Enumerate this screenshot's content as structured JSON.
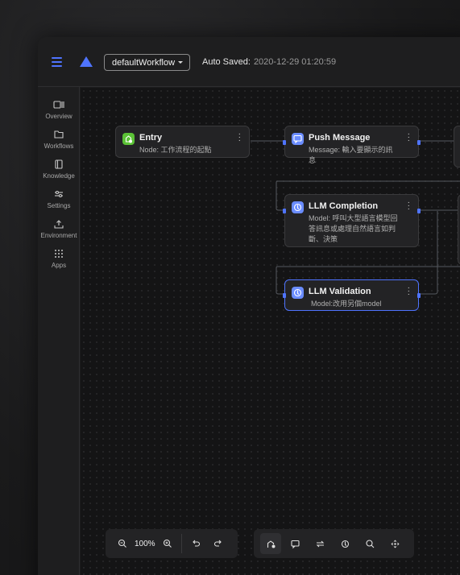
{
  "header": {
    "workflow_name": "defaultWorkflow",
    "autosave_label": "Auto Saved:",
    "autosave_time": "2020-12-29 01:20:59"
  },
  "sidebar": {
    "items": [
      {
        "label": "Overview",
        "icon": "overview-icon"
      },
      {
        "label": "Workflows",
        "icon": "folder-icon"
      },
      {
        "label": "Knowledge",
        "icon": "book-icon"
      },
      {
        "label": "Settings",
        "icon": "sliders-icon"
      },
      {
        "label": "Environment",
        "icon": "upload-icon"
      },
      {
        "label": "Apps",
        "icon": "grid-icon"
      }
    ]
  },
  "nodes": [
    {
      "title": "Entry",
      "desc": "Node: 工作流程的起點",
      "icon": "entry-icon",
      "icon_color": "#5bc236"
    },
    {
      "title": "Push Message",
      "desc": "Message: 輸入要顯示的訊息",
      "icon": "message-icon",
      "icon_color": "#6a8cff"
    },
    {
      "title": "LLM Completion",
      "desc": "Model: 呼叫大型語言模型回答訊息或處理自然語言如判斷、決策",
      "icon": "llm-icon",
      "icon_color": "#6a8cff"
    },
    {
      "title": "LLM Validation",
      "desc": "Model:改用另個model",
      "icon": "llm-icon",
      "icon_color": "#6a8cff"
    }
  ],
  "zoom": {
    "level": "100%"
  },
  "colors": {
    "accent": "#4f74ff",
    "entry": "#5bc236"
  }
}
